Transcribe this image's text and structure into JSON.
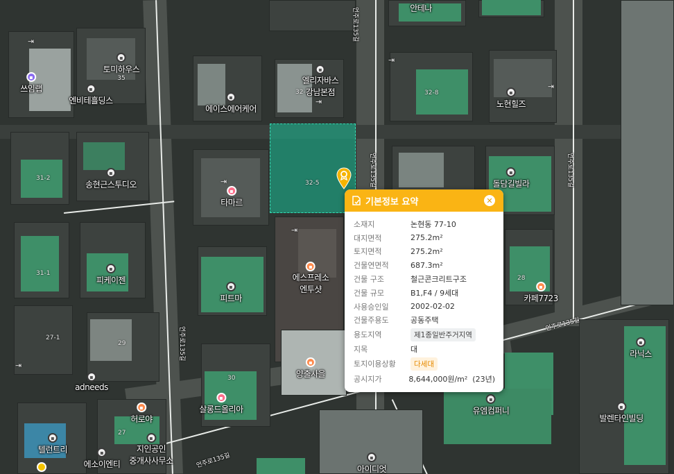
{
  "popup": {
    "title": "기본정보 요약",
    "rows": [
      {
        "key": "소재지",
        "value": "논현동 77-10"
      },
      {
        "key": "대지면적",
        "value": "275.2m²"
      },
      {
        "key": "토지면적",
        "value": "275.2m²"
      },
      {
        "key": "건물연면적",
        "value": "687.3m²"
      },
      {
        "key": "건물 구조",
        "value": "철근콘크리트구조"
      },
      {
        "key": "건물 규모",
        "value": "B1,F4 / 9세대"
      },
      {
        "key": "사용승인일",
        "value": "2002-02-02"
      },
      {
        "key": "건물주용도",
        "value": "공동주택"
      },
      {
        "key": "용도지역",
        "value": "제1종일반주거지역"
      },
      {
        "key": "지목",
        "value": "대"
      },
      {
        "key": "토지이용상황",
        "value": "다세대"
      },
      {
        "key": "공시지가",
        "value": "8,644,000원/m²  (23년)"
      }
    ]
  },
  "pois": [
    {
      "name": "토미하우스",
      "sub": "35"
    },
    {
      "name": "쓰임랩"
    },
    {
      "name": "엔비테흘딩스"
    },
    {
      "name": "엘리자바스",
      "sub": "강남본점"
    },
    {
      "name": "에이스에어케어"
    },
    {
      "name": "안테나"
    },
    {
      "name": "노현힐즈"
    },
    {
      "name": "송현근스투디오"
    },
    {
      "name": "타마르"
    },
    {
      "name": "돌담길빌라"
    },
    {
      "name": "피케이젠"
    },
    {
      "name": "에스프레소",
      "sub": "엔투샷"
    },
    {
      "name": "피트마"
    },
    {
      "name": "카페7723"
    },
    {
      "name": "adneeds"
    },
    {
      "name": "양출사을"
    },
    {
      "name": "라닉스"
    },
    {
      "name": "살롱드올리아"
    },
    {
      "name": "허로야"
    },
    {
      "name": "유엠컴퍼니"
    },
    {
      "name": "발렌타인빌딩"
    },
    {
      "name": "텔런트리"
    },
    {
      "name": "지인공인",
      "sub": "중개사사무소"
    },
    {
      "name": "에소이엔티"
    },
    {
      "name": "아이디엇"
    }
  ],
  "lot_numbers": [
    "32-7",
    "32-8",
    "31-2",
    "32-5",
    "31-1",
    "28",
    "27-1",
    "29",
    "30",
    "27"
  ],
  "road_names": [
    "언주로135길",
    "언주로135길",
    "언주로135길",
    "언주로135길",
    "언주로135길",
    "언주로135길"
  ],
  "colors": {
    "popup_header": "#fab414",
    "parcel": "#18be96",
    "marker": "#f5b400"
  }
}
